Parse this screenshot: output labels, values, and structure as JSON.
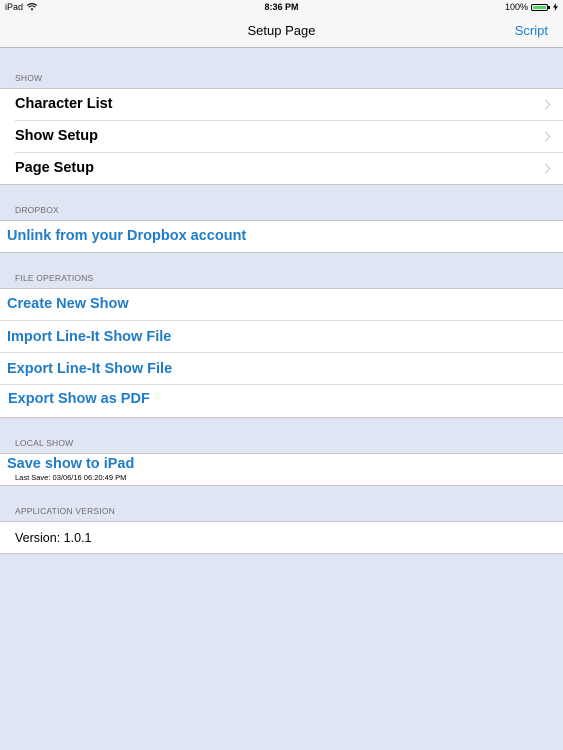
{
  "status_bar": {
    "device": "iPad",
    "wifi_icon": "wifi-icon",
    "time": "8:36 PM",
    "battery_percent": "100%",
    "battery_level": 1.0,
    "battery_color": "#4cd964",
    "charging_icon": "bolt-icon"
  },
  "nav": {
    "title": "Setup Page",
    "right_button": "Script",
    "accent_color": "#1a7fd6"
  },
  "sections": {
    "show": {
      "header": "SHOW",
      "items": [
        {
          "label": "Character List"
        },
        {
          "label": "Show Setup"
        },
        {
          "label": "Page Setup"
        }
      ]
    },
    "dropbox": {
      "header": "DROPBOX",
      "items": [
        {
          "label": "Unlink from your Dropbox account"
        }
      ]
    },
    "file_operations": {
      "header": "FILE OPERATIONS",
      "items": [
        {
          "label": "Create New Show"
        },
        {
          "label": "Import Line-It Show File"
        },
        {
          "label": "Export Line-It Show File"
        },
        {
          "label": "Export Show as PDF"
        }
      ]
    },
    "local_show": {
      "header": "LOCAL SHOW",
      "save_label": "Save show to iPad",
      "last_save": "Last Save: 03/06/16 06:20:49 PM"
    },
    "application_version": {
      "header": "APPLICATION VERSION",
      "version": "Version: 1.0.1"
    }
  }
}
